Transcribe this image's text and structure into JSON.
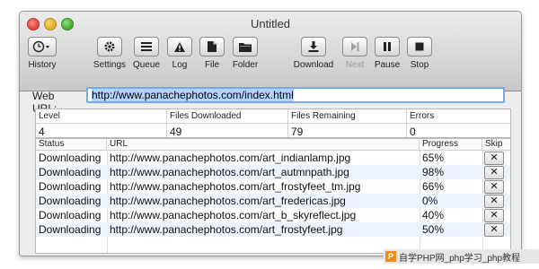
{
  "window": {
    "title": "Untitled"
  },
  "toolbar": {
    "items": [
      {
        "label": "History",
        "icon": "clock-icon"
      },
      {
        "label": "Settings",
        "icon": "gear-icon"
      },
      {
        "label": "Queue",
        "icon": "list-icon"
      },
      {
        "label": "Log",
        "icon": "warning-icon"
      },
      {
        "label": "File",
        "icon": "file-icon"
      },
      {
        "label": "Folder",
        "icon": "folder-icon"
      },
      {
        "label": "Download",
        "icon": "download-icon"
      },
      {
        "label": "Next",
        "icon": "next-icon",
        "disabled": true
      },
      {
        "label": "Pause",
        "icon": "pause-icon"
      },
      {
        "label": "Stop",
        "icon": "stop-icon"
      }
    ]
  },
  "url": {
    "label": "Web URL:",
    "value": "http://www.panachephotos.com/index.html"
  },
  "stats": {
    "headers": [
      "Level",
      "Files Downloaded",
      "Files Remaining",
      "Errors"
    ],
    "values": [
      "4",
      "49",
      "79",
      "0"
    ]
  },
  "list": {
    "headers": [
      "Status",
      "URL",
      "Progress",
      "Skip"
    ],
    "rows": [
      {
        "status": "Downloading",
        "url": "http://www.panachephotos.com/art_indianlamp.jpg",
        "progress": "65%",
        "skip": "✕"
      },
      {
        "status": "Downloading",
        "url": "http://www.panachephotos.com/art_autmnpath.jpg",
        "progress": "98%",
        "skip": "✕"
      },
      {
        "status": "Downloading",
        "url": "http://www.panachephotos.com/art_frostyfeet_tm.jpg",
        "progress": "66%",
        "skip": "✕"
      },
      {
        "status": "Downloading",
        "url": "http://www.panachephotos.com/art_fredericas.jpg",
        "progress": "0%",
        "skip": "✕"
      },
      {
        "status": "Downloading",
        "url": "http://www.panachephotos.com/art_b_skyreflect.jpg",
        "progress": "40%",
        "skip": "✕"
      },
      {
        "status": "Downloading",
        "url": "http://www.panachephotos.com/art_frostyfeet.jpg",
        "progress": "50%",
        "skip": "✕"
      }
    ]
  },
  "watermark": {
    "logo": "P",
    "text": "自学PHP网_php学习_php教程"
  },
  "colors": {
    "accent": "#7aa7e8",
    "selection": "#b4d3fc",
    "row_alt": "#edf3fe"
  }
}
